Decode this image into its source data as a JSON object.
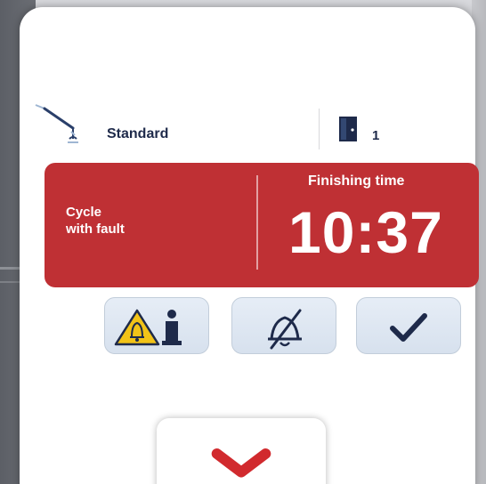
{
  "program": {
    "mode_label": "Standard",
    "tool_icon": "loader-crane-icon"
  },
  "door": {
    "icon": "door-icon",
    "number": "1"
  },
  "status": {
    "cycle_label": "Cycle\nwith fault",
    "finishing_label": "Finishing time",
    "finishing_time": "10:37",
    "color": "#bf3034"
  },
  "actions": [
    {
      "name": "alarm-info-button",
      "icon": "alarm-warning-info-icon"
    },
    {
      "name": "mute-alarm-button",
      "icon": "bell-muted-icon"
    },
    {
      "name": "confirm-button",
      "icon": "checkmark-icon"
    }
  ],
  "bottom": {
    "icon": "close-x-icon",
    "accent": "#d12a2e"
  }
}
